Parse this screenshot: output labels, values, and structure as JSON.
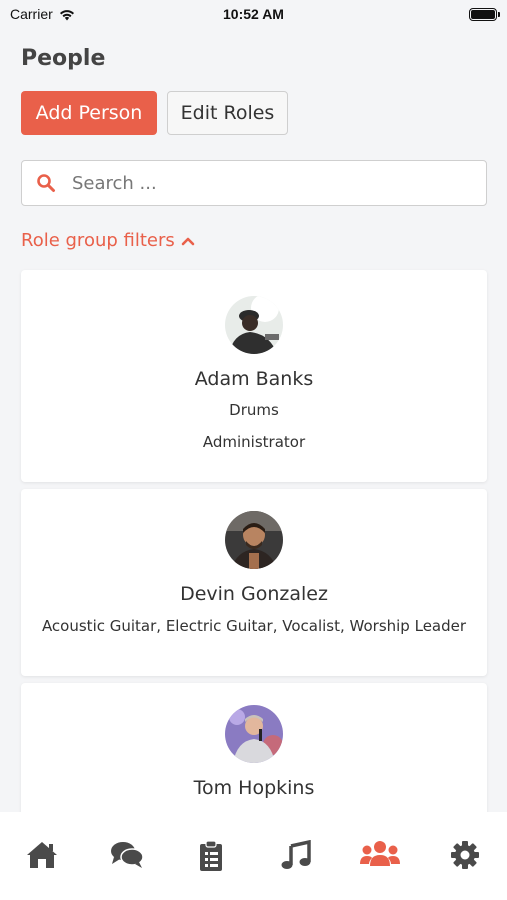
{
  "status_bar": {
    "carrier": "Carrier",
    "time": "10:52 AM"
  },
  "page": {
    "title": "People"
  },
  "actions": {
    "add_person": "Add Person",
    "edit_roles": "Edit Roles"
  },
  "search": {
    "placeholder": "Search ..."
  },
  "filters": {
    "label": "Role group filters"
  },
  "people": [
    {
      "name": "Adam Banks",
      "lines": [
        "Drums",
        "Administrator"
      ]
    },
    {
      "name": "Devin Gonzalez",
      "lines": [
        "Acoustic Guitar, Electric Guitar, Vocalist, Worship Leader"
      ]
    },
    {
      "name": "Tom Hopkins",
      "lines": []
    }
  ],
  "tabbar": {
    "items": [
      "home-icon",
      "chat-icon",
      "clipboard-icon",
      "music-icon",
      "people-icon",
      "settings-icon"
    ],
    "active": "people-icon"
  },
  "colors": {
    "accent": "#e9604a",
    "tab_inactive": "#4a4a4a"
  }
}
